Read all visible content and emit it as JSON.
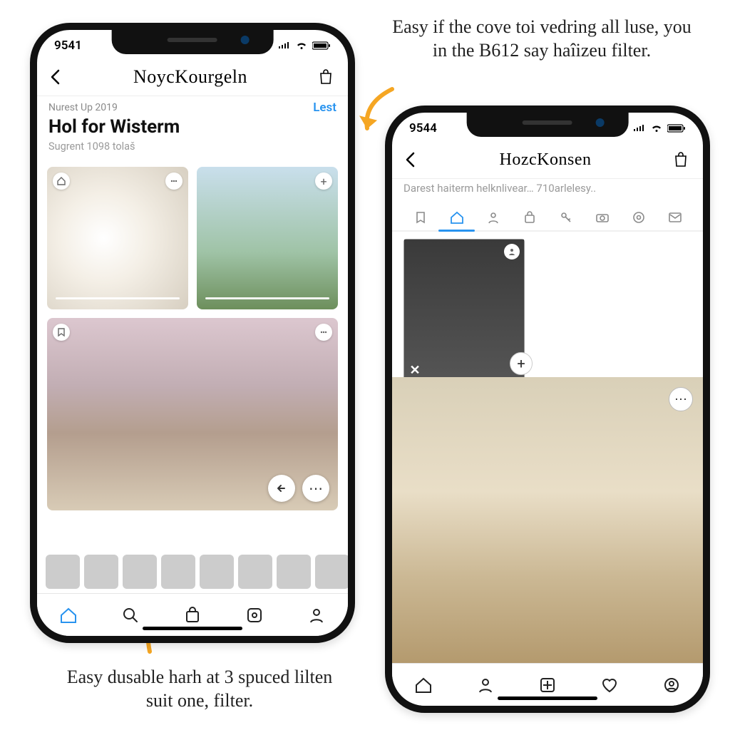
{
  "annotations": {
    "top": "Easy if the cove toi vedring all luse, you in the B612 say haîizeu filter.",
    "bottom": "Easy dusable harh at 3 spuced lilten suit one, filter."
  },
  "phoneLeft": {
    "statusTime": "9541",
    "appTitle": "NoycKourgeln",
    "list": {
      "overline": "Nurest Up 2019",
      "action": "Lest",
      "title": "Hol for Wisterm",
      "subtitle": "Sugrent 1098 tolaš"
    },
    "nav": {
      "home": "home",
      "search": "search",
      "bag": "bag",
      "activity": "activity",
      "profile": "profile"
    }
  },
  "phoneRight": {
    "statusTime": "9544",
    "appTitle": "HozcKonsen",
    "searchPlaceholder": "Darest haiterm helknlivear… 710arlelesy..",
    "tabIcons": [
      "home",
      "person",
      "bag",
      "key",
      "camera",
      "target",
      "mail"
    ],
    "nav": {
      "home": "home",
      "profile": "profile",
      "grid": "grid",
      "heart": "heart",
      "account": "account"
    }
  },
  "icons": {
    "signal": "signal-icon",
    "wifi": "wifi-icon",
    "battery": "battery-icon",
    "back": "chevron-left-icon",
    "bag": "shopping-bag-icon",
    "home": "home-icon",
    "search": "search-icon",
    "activity": "activity-icon",
    "profile": "profile-icon",
    "close": "close-icon",
    "plus": "plus-icon",
    "more": "more-icon",
    "arrowLeft": "arrow-left-icon"
  }
}
